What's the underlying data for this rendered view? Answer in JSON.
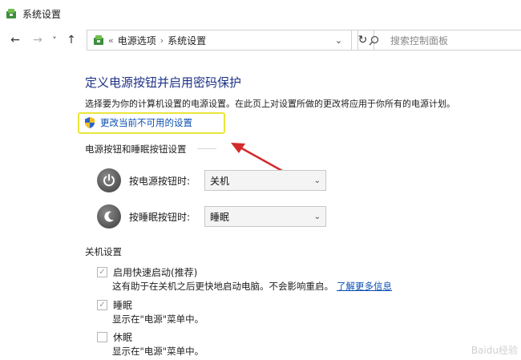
{
  "window": {
    "title": "系统设置"
  },
  "nav": {
    "back": "←",
    "forward": "→",
    "recent": "˅",
    "up": "↑",
    "breadcrumb": [
      "电源选项",
      "系统设置"
    ],
    "breadcrumb_prefix": "«",
    "breadcrumb_sep": "›",
    "refresh": "↻",
    "search_placeholder": "搜索控制面板"
  },
  "main": {
    "heading": "定义电源按钮并启用密码保护",
    "description": "选择要为你的计算机设置的电源设置。在此页上对设置所做的更改将应用于你所有的电源计划。",
    "change_link": "更改当前不可用的设置",
    "power_group": {
      "title": "电源按钮和睡眠按钮设置",
      "power_button": {
        "label": "按电源按钮时:",
        "value": "关机"
      },
      "sleep_button": {
        "label": "按睡眠按钮时:",
        "value": "睡眠"
      }
    },
    "shutdown_group": {
      "title": "关机设置",
      "items": [
        {
          "label": "启用快速启动(推荐)",
          "checked": true,
          "desc": "这有助于在关机之后更快地启动电脑。不会影响重启。",
          "link": "了解更多信息"
        },
        {
          "label": "睡眠",
          "checked": true,
          "desc": "显示在\"电源\"菜单中。"
        },
        {
          "label": "休眠",
          "checked": false,
          "desc": "显示在\"电源\"菜单中。"
        }
      ]
    }
  },
  "colors": {
    "heading": "#1e3287",
    "link": "#0b4fb4",
    "highlight_box": "#e9e63a",
    "annotation_arrow": "#d42a2a"
  },
  "watermark": "Baidu经验"
}
